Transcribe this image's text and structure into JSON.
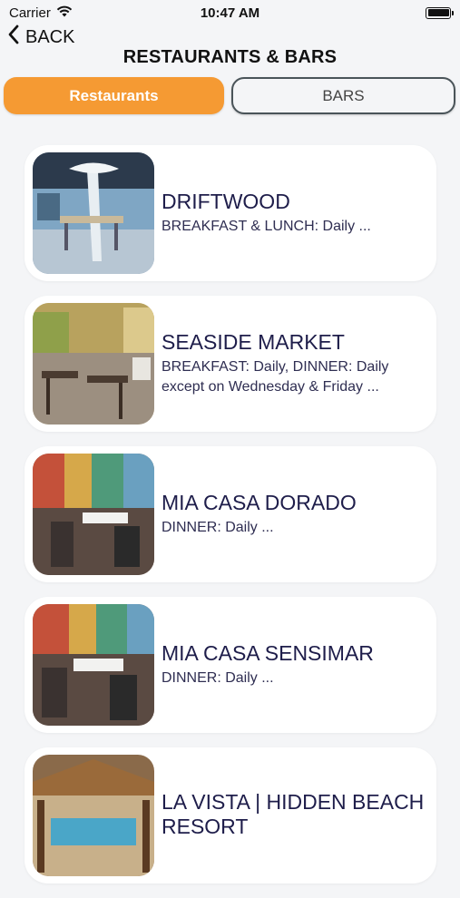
{
  "status_bar": {
    "carrier": "Carrier",
    "time": "10:47 AM"
  },
  "nav": {
    "back_label": "BACK",
    "title": "RESTAURANTS & BARS"
  },
  "tabs": [
    {
      "label": "Restaurants",
      "active": true
    },
    {
      "label": "BARS",
      "active": false
    }
  ],
  "colors": {
    "accent": "#f59a33",
    "title_text": "#1e1d4a",
    "background": "#f4f5f7"
  },
  "venues": [
    {
      "name": "DRIFTWOOD",
      "hours": "BREAKFAST & LUNCH: Daily ..."
    },
    {
      "name": "SEASIDE MARKET",
      "hours": "BREAKFAST: Daily, DINNER: Daily except on Wednesday & Friday ..."
    },
    {
      "name": "MIA CASA DORADO",
      "hours": "DINNER: Daily ..."
    },
    {
      "name": "MIA CASA SENSIMAR",
      "hours": "DINNER: Daily ..."
    },
    {
      "name": "LA VISTA | HIDDEN BEACH RESORT",
      "hours": ""
    }
  ]
}
